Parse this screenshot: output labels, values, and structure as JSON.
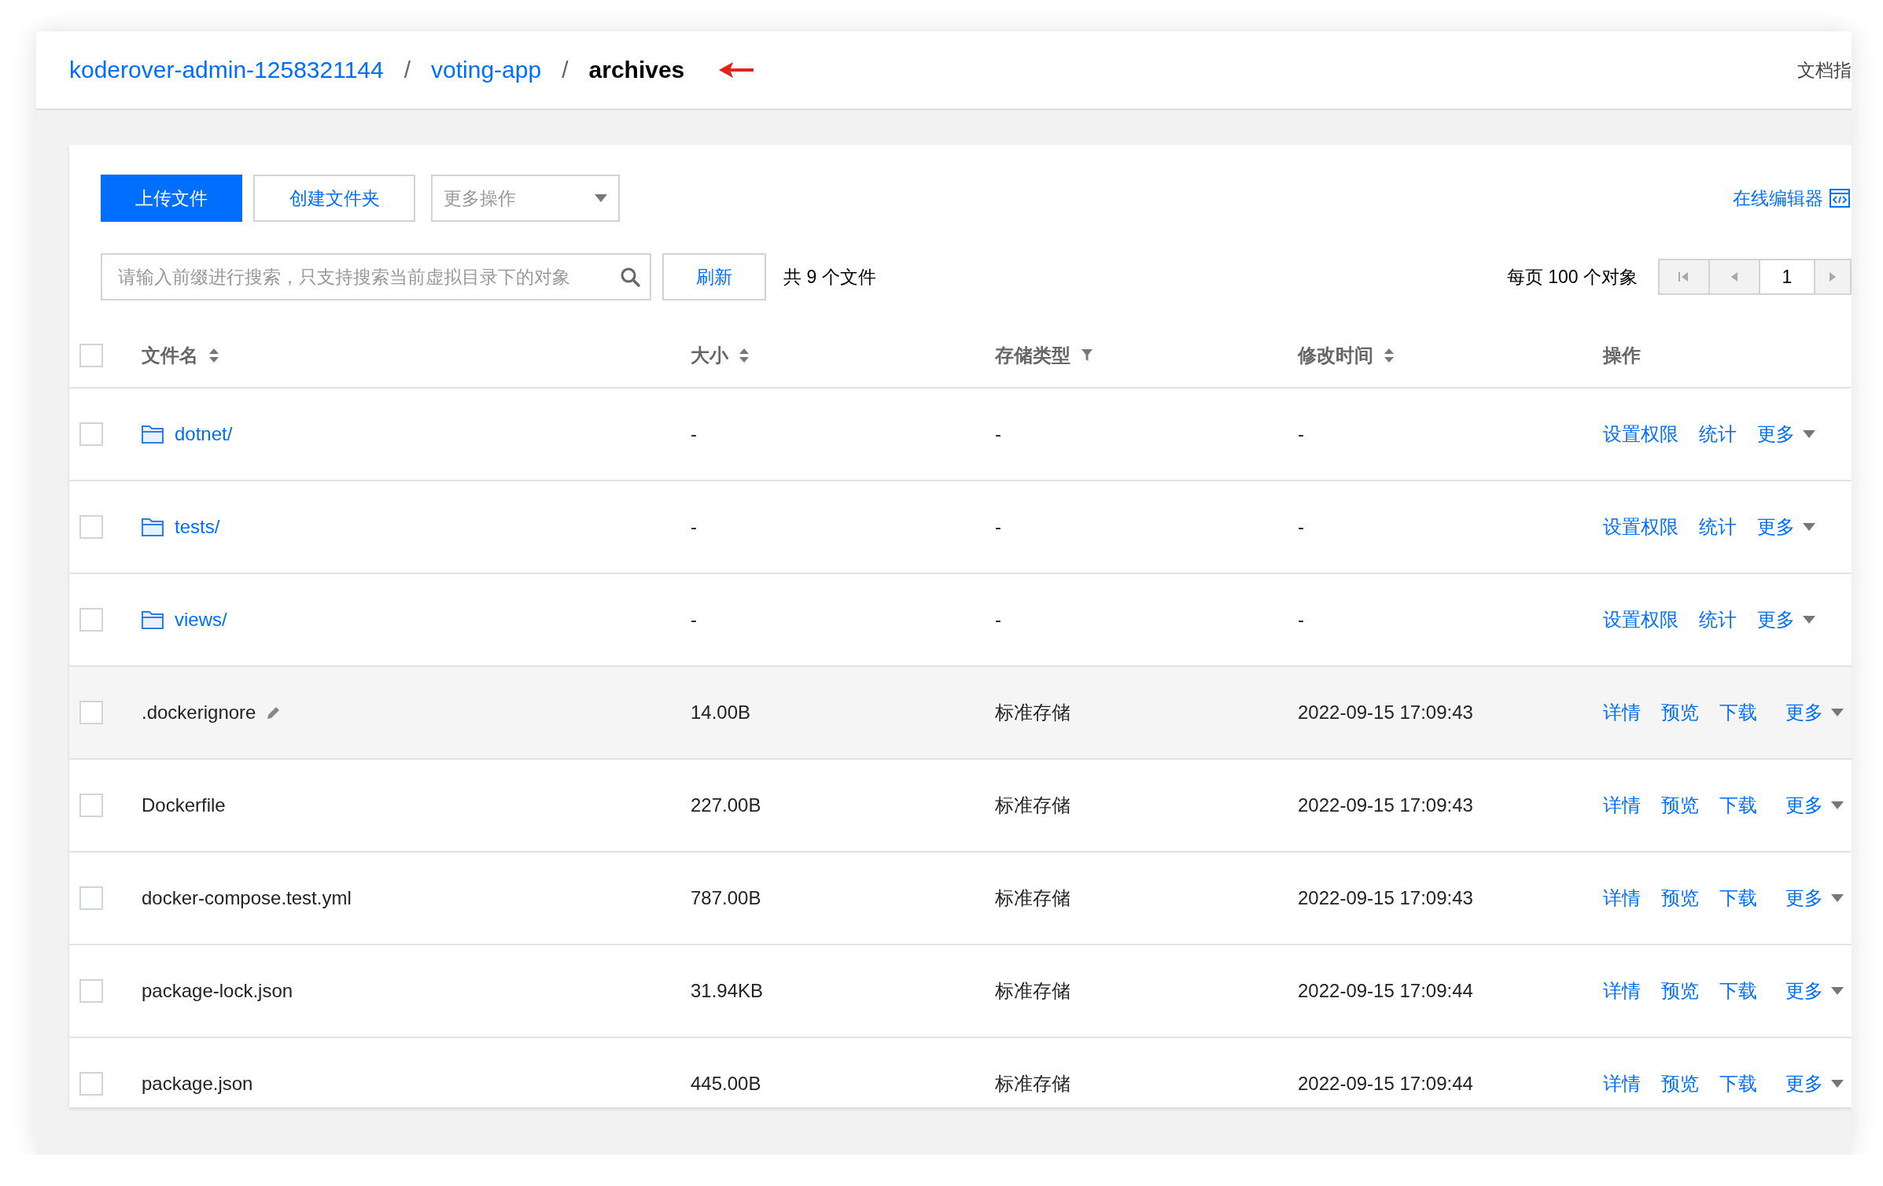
{
  "breadcrumb": [
    {
      "label": "koderover-admin-1258321144",
      "kind": "link"
    },
    {
      "label": "voting-app",
      "kind": "link",
      "separator": "/"
    },
    {
      "label": "archives",
      "kind": "current",
      "separator": "/"
    }
  ],
  "header_link": "文档指",
  "toolbar": {
    "buttons": [
      {
        "label": "上传文件",
        "kind": "primary"
      },
      {
        "label": "创建文件夹",
        "kind": "default"
      }
    ],
    "dropdown": {
      "label": "更多操作"
    },
    "editor_link": "在线编辑器"
  },
  "search": {
    "placeholder": "请输入前缀进行搜索，只支持搜索当前虚拟目录下的对象"
  },
  "refresh_button": "刷新",
  "file_count": "共 9 个文件",
  "page_size": "每页 100 个对象",
  "pagination": {
    "page": "1"
  },
  "table": {
    "select_all": {
      "checked": false
    },
    "columns": [
      {
        "label": "文件名",
        "kind": "sortable"
      },
      {
        "label": "大小",
        "kind": "sortable"
      },
      {
        "label": "存储类型",
        "kind": "filterable"
      },
      {
        "label": "修改时间",
        "kind": "sortable"
      },
      {
        "label": "操作",
        "kind": "plain"
      }
    ],
    "rows": [
      {
        "kind": "folder",
        "name": "dotnet/",
        "size": "-",
        "storage": "-",
        "modified": "-",
        "actions": [
          "设置权限",
          "统计"
        ],
        "more": "更多",
        "checked": false,
        "highlighted": false
      },
      {
        "kind": "folder",
        "name": "tests/",
        "size": "-",
        "storage": "-",
        "modified": "-",
        "actions": [
          "设置权限",
          "统计"
        ],
        "more": "更多",
        "checked": false,
        "highlighted": false
      },
      {
        "kind": "folder",
        "name": "views/",
        "size": "-",
        "storage": "-",
        "modified": "-",
        "actions": [
          "设置权限",
          "统计"
        ],
        "more": "更多",
        "checked": false,
        "highlighted": false
      },
      {
        "kind": "file",
        "name": ".dockerignore",
        "size": "14.00B",
        "storage": "标准存储",
        "modified": "2022-09-15 17:09:43",
        "actions": [
          "详情",
          "预览",
          "下载"
        ],
        "more": "更多",
        "checked": false,
        "highlighted": true
      },
      {
        "kind": "file",
        "name": "Dockerfile",
        "size": "227.00B",
        "storage": "标准存储",
        "modified": "2022-09-15 17:09:43",
        "actions": [
          "详情",
          "预览",
          "下载"
        ],
        "more": "更多",
        "checked": false,
        "highlighted": false
      },
      {
        "kind": "file",
        "name": "docker-compose.test.yml",
        "size": "787.00B",
        "storage": "标准存储",
        "modified": "2022-09-15 17:09:43",
        "actions": [
          "详情",
          "预览",
          "下载"
        ],
        "more": "更多",
        "checked": false,
        "highlighted": false
      },
      {
        "kind": "file",
        "name": "package-lock.json",
        "size": "31.94KB",
        "storage": "标准存储",
        "modified": "2022-09-15 17:09:44",
        "actions": [
          "详情",
          "预览",
          "下载"
        ],
        "more": "更多",
        "checked": false,
        "highlighted": false
      },
      {
        "kind": "file",
        "name": "package.json",
        "size": "445.00B",
        "storage": "标准存储",
        "modified": "2022-09-15 17:09:44",
        "actions": [
          "详情",
          "预览",
          "下载"
        ],
        "more": "更多",
        "checked": false,
        "highlighted": false
      }
    ]
  }
}
